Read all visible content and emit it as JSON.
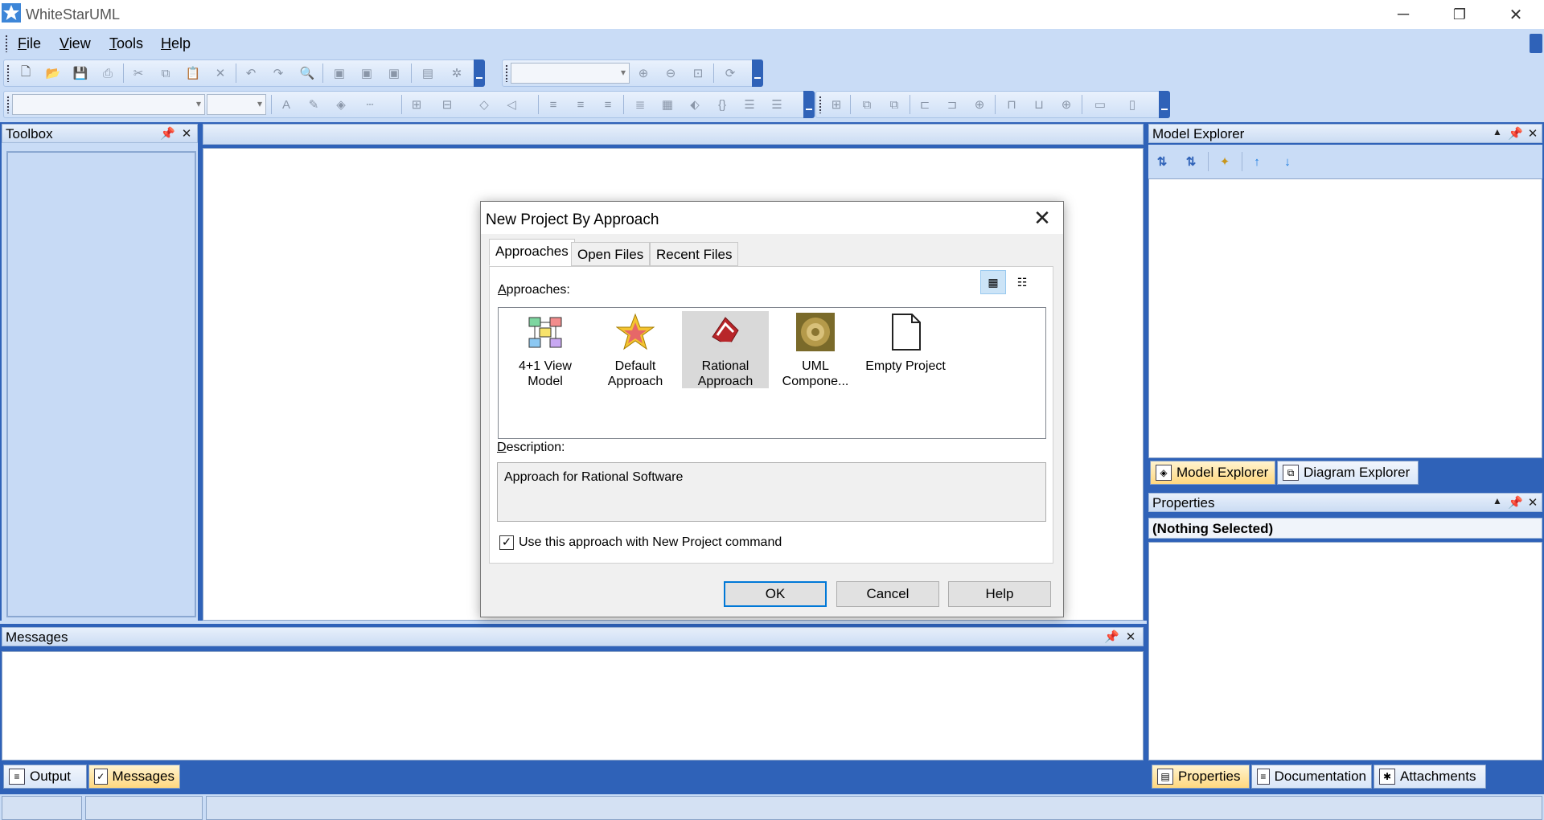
{
  "window": {
    "title": "WhiteStarUML",
    "minimize": "─",
    "restore": "❐",
    "close": "✕"
  },
  "menu": {
    "items": [
      {
        "key": "F",
        "rest": "ile"
      },
      {
        "key": "V",
        "rest": "iew"
      },
      {
        "key": "T",
        "rest": "ools"
      },
      {
        "key": "H",
        "rest": "elp"
      }
    ]
  },
  "panels": {
    "toolbox": {
      "title": "Toolbox"
    },
    "messages": {
      "title": "Messages"
    },
    "model_explorer": {
      "title": "Model Explorer"
    },
    "properties": {
      "title": "Properties",
      "selection": "(Nothing Selected)"
    }
  },
  "bottom_tabs": {
    "messages_panel": [
      {
        "label": "Output",
        "active": false
      },
      {
        "label": "Messages",
        "active": true
      }
    ],
    "explorer_panel": [
      {
        "label": "Model Explorer",
        "active": true
      },
      {
        "label": "Diagram Explorer",
        "active": false
      }
    ],
    "properties_panel": [
      {
        "label": "Properties",
        "active": true
      },
      {
        "label": "Documentation",
        "active": false
      },
      {
        "label": "Attachments",
        "active": false
      }
    ]
  },
  "dialog": {
    "title": "New Project By Approach",
    "close": "✕",
    "tabs": [
      {
        "label": "Approaches",
        "active": true
      },
      {
        "label": "Open Files",
        "active": false
      },
      {
        "label": "Recent Files",
        "active": false
      }
    ],
    "approaches_label_key": "A",
    "approaches_label_rest": "pproaches:",
    "approaches": [
      {
        "line1": "4+1 View",
        "line2": "Model",
        "selected": false
      },
      {
        "line1": "Default",
        "line2": "Approach",
        "selected": false
      },
      {
        "line1": "Rational",
        "line2": "Approach",
        "selected": true
      },
      {
        "line1": "UML",
        "line2": "Compone...",
        "selected": false
      },
      {
        "line1": "Empty Project",
        "line2": "",
        "selected": false
      }
    ],
    "description_label_key": "D",
    "description_label_rest": "escription:",
    "description": "Approach for Rational Software",
    "checkbox_label": "Use this approach with New Project command",
    "checkbox_checked": true,
    "buttons": {
      "ok": "OK",
      "cancel": "Cancel",
      "help": "Help"
    }
  },
  "colors": {
    "frame_blue": "#2f62b8",
    "panel_bg": "#c9dcf6",
    "active_tab": "#ffd87f",
    "default_button_border": "#0078d7"
  }
}
